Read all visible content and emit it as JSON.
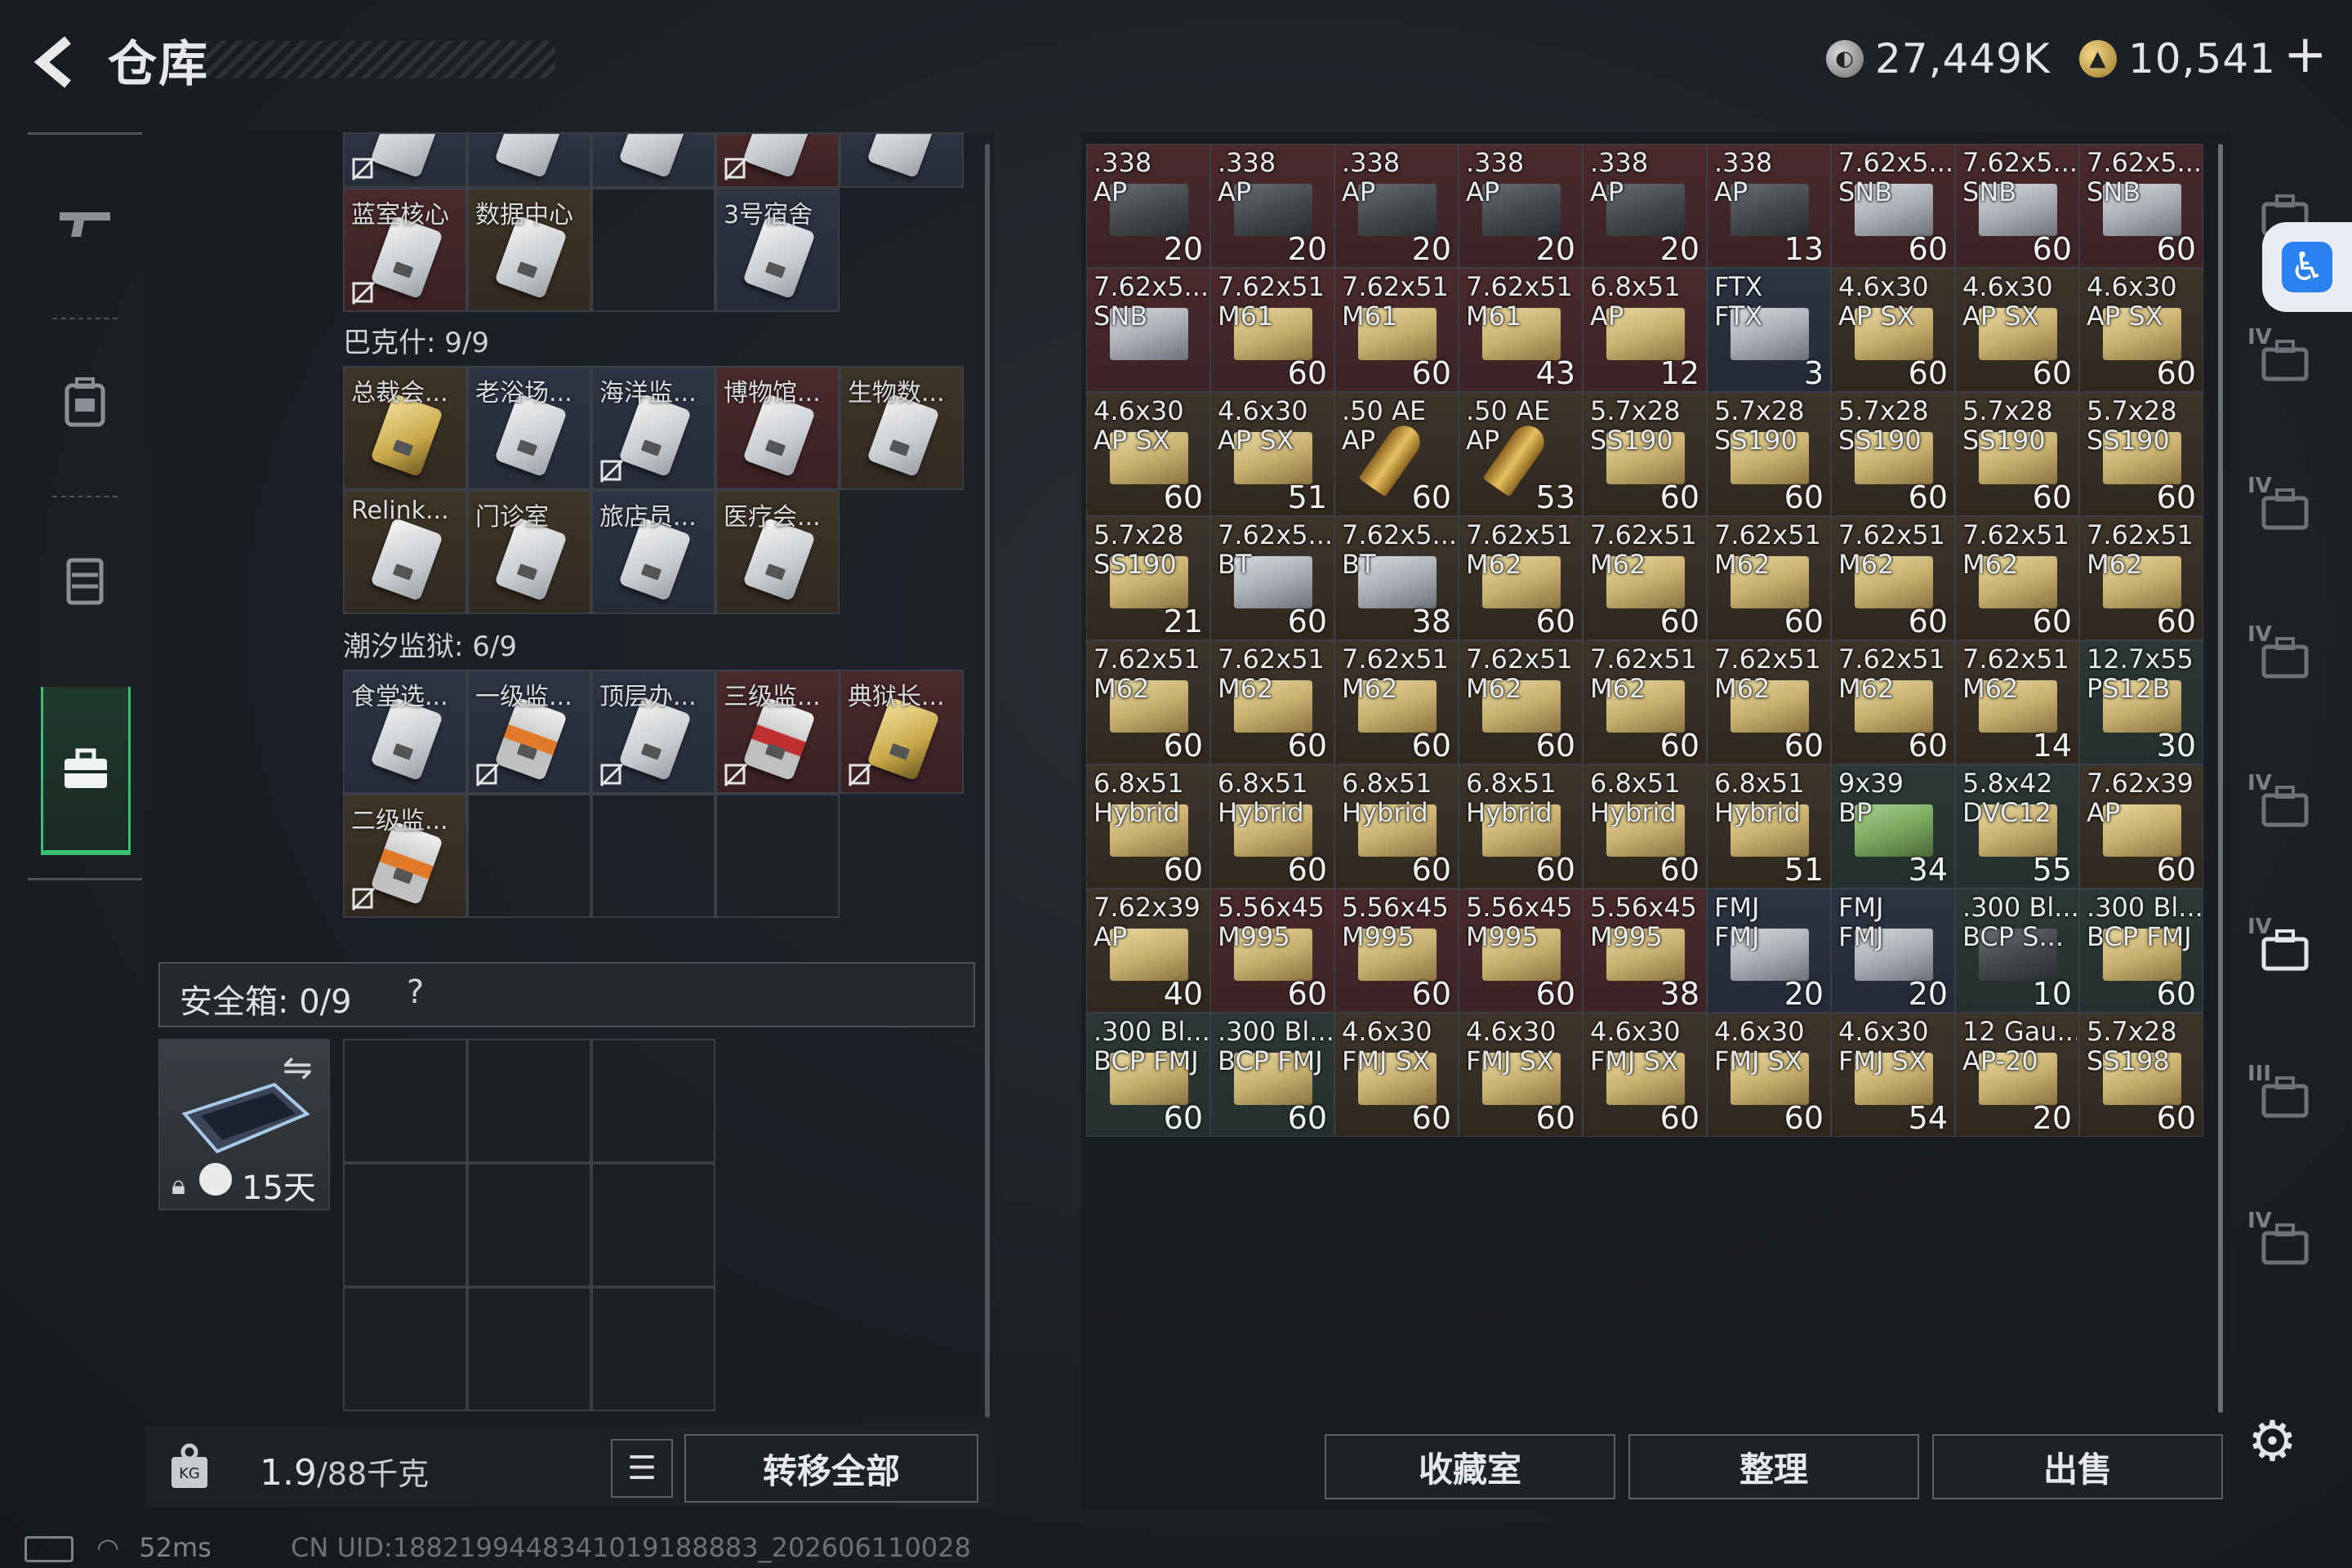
{
  "header": {
    "title": "仓库",
    "currency1": "27,449K",
    "currency2": "10,541",
    "plus": "+"
  },
  "left_nav": [
    "gun-icon",
    "backpack-icon",
    "vest-icon",
    "briefcase-icon"
  ],
  "sections": {
    "top_partial": [
      {
        "name": "",
        "color": "blue",
        "broken": true
      },
      {
        "name": "",
        "color": "blue",
        "broken": false
      },
      {
        "name": "",
        "color": "blue",
        "broken": false
      },
      {
        "name": "",
        "color": "red",
        "broken": true
      },
      {
        "name": "",
        "color": "blue",
        "broken": false
      }
    ],
    "top_row2": [
      {
        "name": "蓝室核心",
        "color": "red",
        "broken": true,
        "card": "white"
      },
      {
        "name": "数据中心",
        "color": "brown",
        "broken": false,
        "card": "white"
      },
      {
        "name": "",
        "color": "empty",
        "broken": false,
        "card": ""
      },
      {
        "name": "3号宿舍",
        "color": "blue",
        "broken": false,
        "card": "white"
      }
    ],
    "bakshi_label": "巴克什: 9/9",
    "bakshi_row1": [
      {
        "name": "总裁会...",
        "color": "brown",
        "broken": false,
        "card": "gold"
      },
      {
        "name": "老浴场...",
        "color": "blue",
        "broken": false,
        "card": "white"
      },
      {
        "name": "海洋监...",
        "color": "blue",
        "broken": true,
        "card": "white"
      },
      {
        "name": "博物馆...",
        "color": "red",
        "broken": false,
        "card": "white"
      },
      {
        "name": "生物数...",
        "color": "brown",
        "broken": false,
        "card": "white"
      }
    ],
    "bakshi_row2": [
      {
        "name": "Relink...",
        "color": "brown",
        "broken": false,
        "card": "white"
      },
      {
        "name": "门诊室",
        "color": "brown",
        "broken": false,
        "card": "white"
      },
      {
        "name": "旅店员...",
        "color": "blue",
        "broken": false,
        "card": "white"
      },
      {
        "name": "医疗会...",
        "color": "brown",
        "broken": false,
        "card": "white"
      }
    ],
    "prison_label": "潮汐监狱: 6/9",
    "prison_row1": [
      {
        "name": "食堂选...",
        "color": "blue",
        "broken": false,
        "card": "white"
      },
      {
        "name": "一级监...",
        "color": "blue",
        "broken": true,
        "card": "orange"
      },
      {
        "name": "顶层办...",
        "color": "blue",
        "broken": true,
        "card": "white"
      },
      {
        "name": "三级监...",
        "color": "red",
        "broken": true,
        "card": "redstrip"
      },
      {
        "name": "典狱长...",
        "color": "red",
        "broken": true,
        "card": "gold"
      }
    ],
    "prison_row2": [
      {
        "name": "二级监...",
        "color": "brown",
        "broken": true,
        "card": "orange"
      }
    ]
  },
  "safebox": {
    "label": "安全箱: 0/9",
    "help": "?",
    "timer": "15天"
  },
  "bottom_left": {
    "weight_current": "1.9",
    "weight_max": "/88千克",
    "transfer_label": "转移全部"
  },
  "status": {
    "ping": "52ms",
    "uid": "CN UID:1882199448341019188883_202606110028"
  },
  "ammo": [
    {
      "name": ".338\nAP",
      "count": "20",
      "bg": "r",
      "box": "dark"
    },
    {
      "name": ".338\nAP",
      "count": "20",
      "bg": "r",
      "box": "dark"
    },
    {
      "name": ".338\nAP",
      "count": "20",
      "bg": "r",
      "box": "dark"
    },
    {
      "name": ".338\nAP",
      "count": "20",
      "bg": "r",
      "box": "dark"
    },
    {
      "name": ".338\nAP",
      "count": "20",
      "bg": "r",
      "box": "dark"
    },
    {
      "name": ".338\nAP",
      "count": "13",
      "bg": "r",
      "box": "dark"
    },
    {
      "name": "7.62x5...\nSNB",
      "count": "60",
      "bg": "r",
      "box": "steel"
    },
    {
      "name": "7.62x5...\nSNB",
      "count": "60",
      "bg": "r",
      "box": "steel"
    },
    {
      "name": "7.62x5...\nSNB",
      "count": "60",
      "bg": "r",
      "box": "steel"
    },
    {
      "name": "7.62x5...\nSNB",
      "count": "",
      "bg": "r",
      "box": "steel"
    },
    {
      "name": "7.62x51\nM61",
      "count": "60",
      "bg": "r",
      "box": "sand"
    },
    {
      "name": "7.62x51\nM61",
      "count": "60",
      "bg": "r",
      "box": "sand"
    },
    {
      "name": "7.62x51\nM61",
      "count": "43",
      "bg": "r",
      "box": "sand"
    },
    {
      "name": "6.8x51\nAP",
      "count": "12",
      "bg": "r",
      "box": "sand"
    },
    {
      "name": "FTX\nFTX",
      "count": "3",
      "bg": "u",
      "box": "steel"
    },
    {
      "name": "4.6x30\nAP SX",
      "count": "60",
      "bg": "b",
      "box": "sand"
    },
    {
      "name": "4.6x30\nAP SX",
      "count": "60",
      "bg": "b",
      "box": "sand"
    },
    {
      "name": "4.6x30\nAP SX",
      "count": "60",
      "bg": "b",
      "box": "sand"
    },
    {
      "name": "4.6x30\nAP SX",
      "count": "60",
      "bg": "b",
      "box": "sand"
    },
    {
      "name": "4.6x30\nAP SX",
      "count": "51",
      "bg": "b",
      "box": "sand"
    },
    {
      "name": ".50 AE\nAP",
      "count": "60",
      "bg": "b",
      "box": "bullet"
    },
    {
      "name": ".50 AE\nAP",
      "count": "53",
      "bg": "b",
      "box": "bullet"
    },
    {
      "name": "5.7x28\nSS190",
      "count": "60",
      "bg": "b",
      "box": "sand"
    },
    {
      "name": "5.7x28\nSS190",
      "count": "60",
      "bg": "b",
      "box": "sand"
    },
    {
      "name": "5.7x28\nSS190",
      "count": "60",
      "bg": "b",
      "box": "sand"
    },
    {
      "name": "5.7x28\nSS190",
      "count": "60",
      "bg": "b",
      "box": "sand"
    },
    {
      "name": "5.7x28\nSS190",
      "count": "60",
      "bg": "b",
      "box": "sand"
    },
    {
      "name": "5.7x28\nSS190",
      "count": "21",
      "bg": "b",
      "box": "sand"
    },
    {
      "name": "7.62x5...\nBT",
      "count": "60",
      "bg": "b",
      "box": "steel"
    },
    {
      "name": "7.62x5...\nBT",
      "count": "38",
      "bg": "b",
      "box": "steel"
    },
    {
      "name": "7.62x51\nM62",
      "count": "60",
      "bg": "b",
      "box": "sand"
    },
    {
      "name": "7.62x51\nM62",
      "count": "60",
      "bg": "b",
      "box": "sand"
    },
    {
      "name": "7.62x51\nM62",
      "count": "60",
      "bg": "b",
      "box": "sand"
    },
    {
      "name": "7.62x51\nM62",
      "count": "60",
      "bg": "b",
      "box": "sand"
    },
    {
      "name": "7.62x51\nM62",
      "count": "60",
      "bg": "b",
      "box": "sand"
    },
    {
      "name": "7.62x51\nM62",
      "count": "60",
      "bg": "b",
      "box": "sand"
    },
    {
      "name": "7.62x51\nM62",
      "count": "60",
      "bg": "b",
      "box": "sand"
    },
    {
      "name": "7.62x51\nM62",
      "count": "60",
      "bg": "b",
      "box": "sand"
    },
    {
      "name": "7.62x51\nM62",
      "count": "60",
      "bg": "b",
      "box": "sand"
    },
    {
      "name": "7.62x51\nM62",
      "count": "60",
      "bg": "b",
      "box": "sand"
    },
    {
      "name": "7.62x51\nM62",
      "count": "60",
      "bg": "b",
      "box": "sand"
    },
    {
      "name": "7.62x51\nM62",
      "count": "60",
      "bg": "b",
      "box": "sand"
    },
    {
      "name": "7.62x51\nM62",
      "count": "60",
      "bg": "b",
      "box": "sand"
    },
    {
      "name": "7.62x51\nM62",
      "count": "14",
      "bg": "b",
      "box": "sand"
    },
    {
      "name": "12.7x55\nPS12B",
      "count": "30",
      "bg": "g",
      "box": "sand"
    },
    {
      "name": "6.8x51\nHybrid",
      "count": "60",
      "bg": "b",
      "box": "sand"
    },
    {
      "name": "6.8x51\nHybrid",
      "count": "60",
      "bg": "b",
      "box": "sand"
    },
    {
      "name": "6.8x51\nHybrid",
      "count": "60",
      "bg": "b",
      "box": "sand"
    },
    {
      "name": "6.8x51\nHybrid",
      "count": "60",
      "bg": "b",
      "box": "sand"
    },
    {
      "name": "6.8x51\nHybrid",
      "count": "60",
      "bg": "b",
      "box": "sand"
    },
    {
      "name": "6.8x51\nHybrid",
      "count": "51",
      "bg": "b",
      "box": "sand"
    },
    {
      "name": "9x39\nBP",
      "count": "34",
      "bg": "g",
      "box": "green"
    },
    {
      "name": "5.8x42\nDVC12",
      "count": "55",
      "bg": "g",
      "box": "sand"
    },
    {
      "name": "7.62x39\nAP",
      "count": "60",
      "bg": "b",
      "box": "sand"
    },
    {
      "name": "7.62x39\nAP",
      "count": "40",
      "bg": "b",
      "box": "sand"
    },
    {
      "name": "5.56x45\nM995",
      "count": "60",
      "bg": "r",
      "box": "sand"
    },
    {
      "name": "5.56x45\nM995",
      "count": "60",
      "bg": "r",
      "box": "sand"
    },
    {
      "name": "5.56x45\nM995",
      "count": "60",
      "bg": "r",
      "box": "sand"
    },
    {
      "name": "5.56x45\nM995",
      "count": "38",
      "bg": "r",
      "box": "sand"
    },
    {
      "name": "FMJ\nFMJ",
      "count": "20",
      "bg": "u",
      "box": "steel"
    },
    {
      "name": "FMJ\nFMJ",
      "count": "20",
      "bg": "u",
      "box": "steel"
    },
    {
      "name": ".300 Bl...\nBCP S...",
      "count": "10",
      "bg": "g",
      "box": "dark"
    },
    {
      "name": ".300 Bl...\nBCP FMJ",
      "count": "60",
      "bg": "g",
      "box": "sand"
    },
    {
      "name": ".300 Bl...\nBCP FMJ",
      "count": "60",
      "bg": "g",
      "box": "sand"
    },
    {
      "name": ".300 Bl...\nBCP FMJ",
      "count": "60",
      "bg": "g",
      "box": "sand"
    },
    {
      "name": "4.6x30\nFMJ SX",
      "count": "60",
      "bg": "b",
      "box": "sand"
    },
    {
      "name": "4.6x30\nFMJ SX",
      "count": "60",
      "bg": "b",
      "box": "sand"
    },
    {
      "name": "4.6x30\nFMJ SX",
      "count": "60",
      "bg": "b",
      "box": "sand"
    },
    {
      "name": "4.6x30\nFMJ SX",
      "count": "60",
      "bg": "b",
      "box": "sand"
    },
    {
      "name": "4.6x30\nFMJ SX",
      "count": "54",
      "bg": "b",
      "box": "sand"
    },
    {
      "name": "12 Gau...\nAP-20",
      "count": "20",
      "bg": "b",
      "box": "sand"
    },
    {
      "name": "5.7x28\nSS198",
      "count": "60",
      "bg": "b",
      "box": "sand"
    }
  ],
  "right_nav": [
    {
      "icon": "helmet-icon",
      "level": ""
    },
    {
      "icon": "gun-case-icon",
      "level": "IV"
    },
    {
      "icon": "warning-case-icon",
      "level": "IV"
    },
    {
      "icon": "medical-case-icon",
      "level": "IV"
    },
    {
      "icon": "ammo-case-icon",
      "level": "IV"
    },
    {
      "icon": "rifle-case-icon",
      "level": "IV"
    },
    {
      "icon": "warning-case-icon",
      "level": "III"
    },
    {
      "icon": "weapon-case-icon",
      "level": "IV"
    }
  ],
  "bottom_right": {
    "collection_label": "收藏室",
    "sort_label": "整理",
    "sell_label": "出售"
  },
  "colors": {
    "accent_green": "#3bbf70",
    "accessibility_blue": "#2a82f0"
  }
}
